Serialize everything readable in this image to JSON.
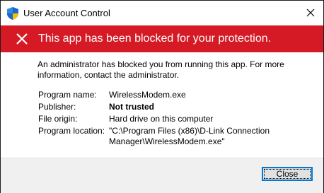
{
  "window": {
    "title": "User Account Control",
    "title_icon": "shield-icon",
    "close_icon": "close-icon"
  },
  "banner": {
    "icon": "blocked-x-icon",
    "text": "This app has been blocked for your protection.",
    "color": "#d51a25"
  },
  "message": "An administrator has blocked you from running this app. For more information, contact the administrator.",
  "details": {
    "program_name_label": "Program name:",
    "program_name_value": "WirelessModem.exe",
    "publisher_label": "Publisher:",
    "publisher_value": "Not trusted",
    "file_origin_label": "File origin:",
    "file_origin_value": "Hard drive on this computer",
    "program_location_label": "Program location:",
    "program_location_value": "\"C:\\Program Files (x86)\\D-Link Connection Manager\\WirelessModem.exe\""
  },
  "footer": {
    "close_label": "Close",
    "accent_color": "#0078d7"
  }
}
